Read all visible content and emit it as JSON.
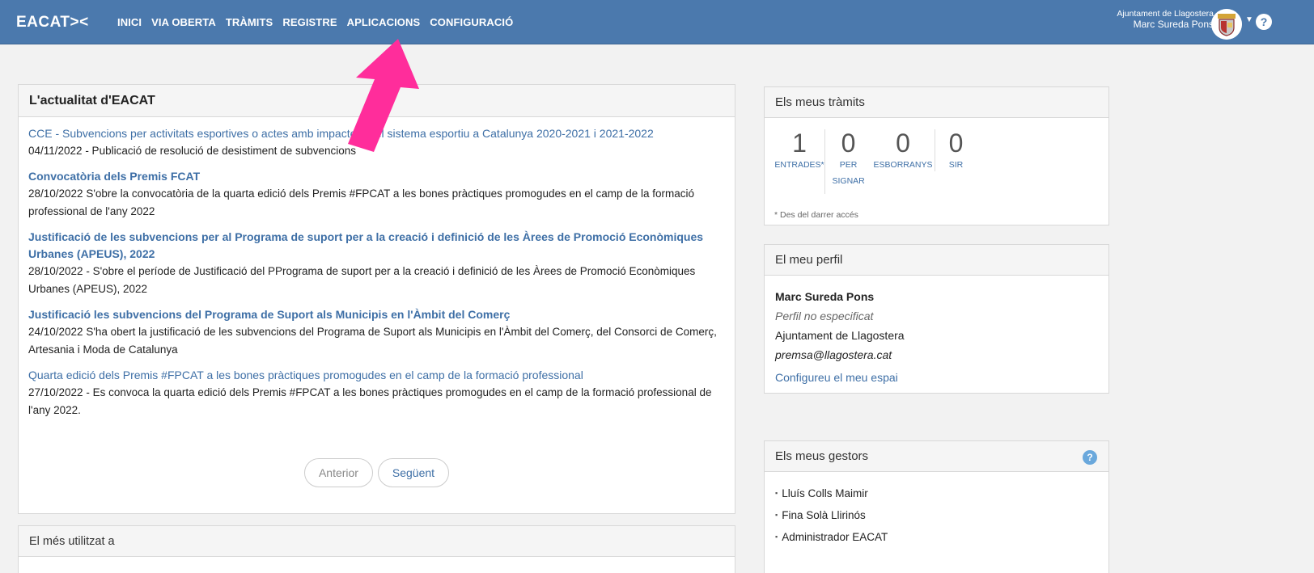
{
  "header": {
    "logo": "EACAT><",
    "nav": [
      "INICI",
      "VIA OBERTA",
      "TRÀMITS",
      "REGISTRE",
      "APLICACIONS",
      "CONFIGURACIÓ"
    ],
    "org": "Ajuntament de Llagostera",
    "user": "Marc Sureda Pons",
    "help": "?"
  },
  "news": {
    "title": "L'actualitat d'EACAT",
    "items": [
      {
        "title": "CCE - Subvencions per activitats esportives o actes amb impacte en el sistema esportiu a Catalunya 2020-2021 i 2021-2022",
        "bold": false,
        "text": "04/11/2022 - Publicació de resolució de desistiment de subvencions"
      },
      {
        "title": "Convocatòria dels Premis FCAT",
        "bold": true,
        "text": "28/10/2022 S'obre la convocatòria de la quarta edició dels Premis #FPCAT a les bones pràctiques promogudes en el camp de la formació professional de l'any 2022"
      },
      {
        "title": "Justificació de les subvencions per al Programa de suport per a la creació i definició de les Àrees de Promoció Econòmiques Urbanes (APEUS), 2022",
        "bold": true,
        "text": "28/10/2022 - S'obre el període de Justificació del PPrograma de suport per a la creació i definició de les Àrees de Promoció Econòmiques Urbanes (APEUS), 2022"
      },
      {
        "title": "Justificació les subvencions del Programa de Suport als Municipis en l'Àmbit del Comerç",
        "bold": true,
        "text": "24/10/2022 S'ha obert la justificació de les subvencions del Programa de Suport als Municipis en l'Àmbit del Comerç, del Consorci de Comerç, Artesania i Moda de Catalunya"
      },
      {
        "title": "Quarta edició dels Premis #FPCAT a les bones pràctiques promogudes en el camp de la formació professional",
        "bold": false,
        "text": "27/10/2022 - Es convoca la quarta edició dels Premis #FPCAT a les bones pràctiques promogudes en el camp de la formació professional de l'any 2022."
      }
    ],
    "prev": "Anterior",
    "next": "Següent"
  },
  "used": {
    "title": "El més utilitzat a"
  },
  "tramits": {
    "title": "Els meus tràmits",
    "counters": [
      {
        "num": "1",
        "label": "ENTRADES*"
      },
      {
        "num": "0",
        "label": "PER SIGNAR"
      },
      {
        "num": "0",
        "label": "ESBORRANYS"
      },
      {
        "num": "0",
        "label": "SIR"
      }
    ],
    "note": "* Des del darrer accés"
  },
  "perfil": {
    "title": "El meu perfil",
    "name": "Marc Sureda Pons",
    "profile": "Perfil no especificat",
    "org": "Ajuntament de Llagostera",
    "email": "premsa@llagostera.cat",
    "link": "Configureu el meu espai"
  },
  "gestors": {
    "title": "Els meus gestors",
    "help": "?",
    "items": [
      "Lluís Colls Maimir",
      "Fina Solà Llirinós",
      "Administrador EACAT"
    ]
  },
  "colors": {
    "header": "#4b79ad",
    "link": "#3e6fa6",
    "arrow": "#ff2d9b"
  }
}
